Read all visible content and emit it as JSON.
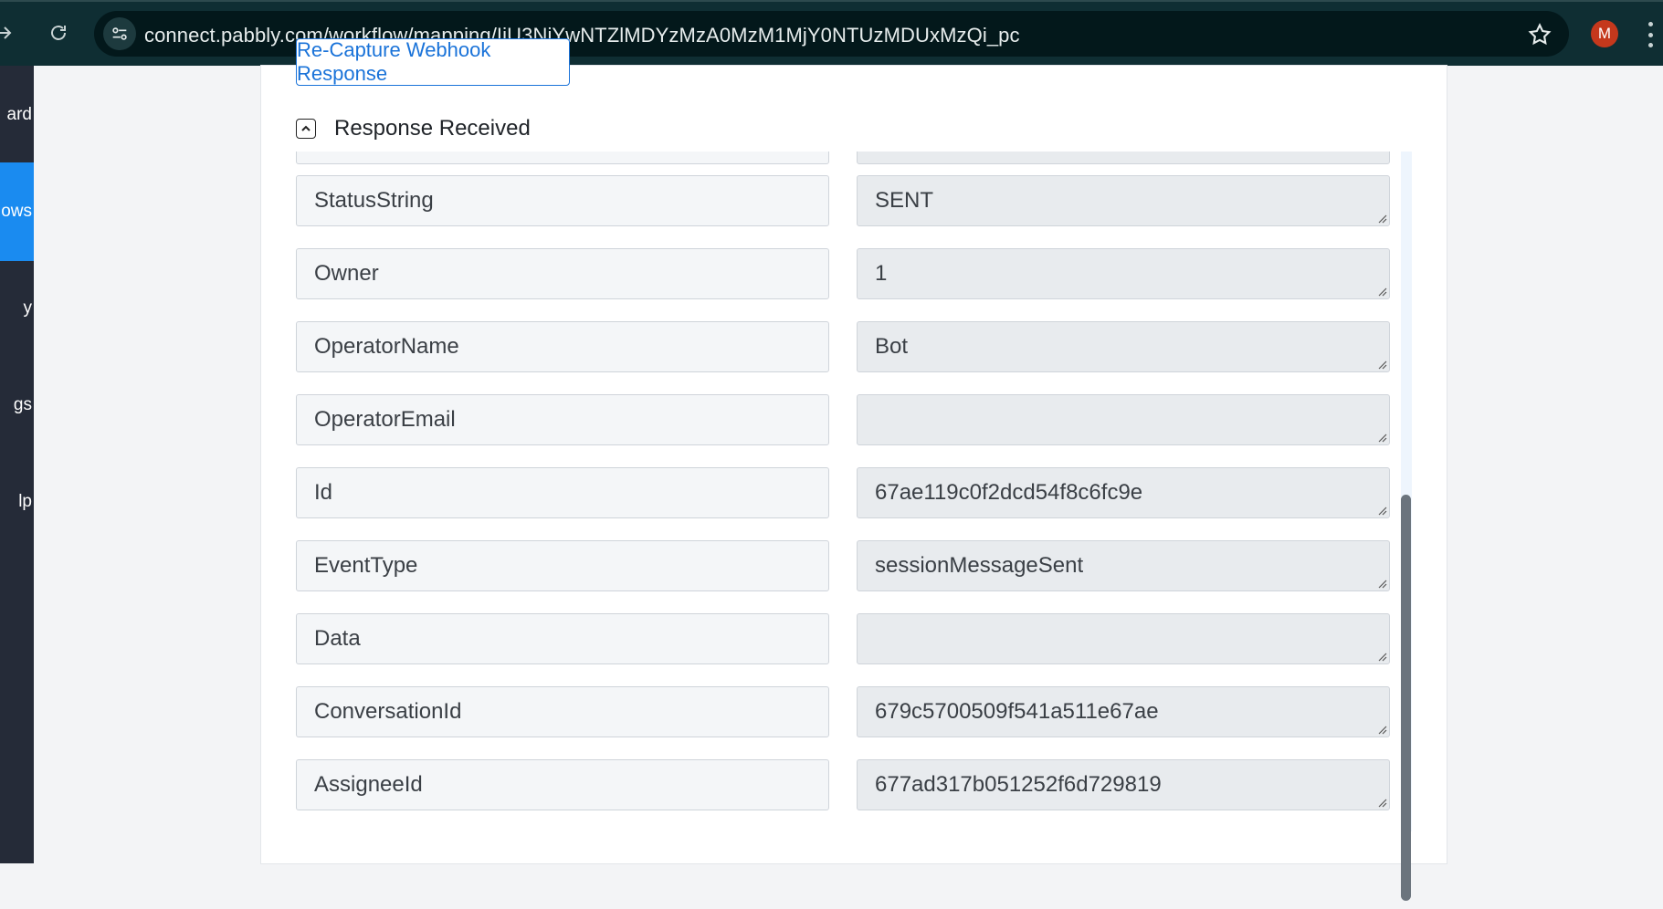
{
  "browser": {
    "url": "connect.pabbly.com/workflow/mapping/IjU3NjYwNTZlMDYzMzA0MzM1MjY0NTUzMDUxMzQi_pc",
    "profile_initial": "M"
  },
  "sidebar": {
    "items": [
      {
        "label": "ard"
      },
      {
        "label": "ows"
      },
      {
        "label": "y"
      },
      {
        "label": "gs"
      },
      {
        "label": "lp"
      }
    ],
    "active_index": 1
  },
  "main": {
    "recapture_label": "Re-Capture Webhook Response",
    "section_title": "Response Received",
    "rows": [
      {
        "key": "StatusString",
        "value": "SENT"
      },
      {
        "key": "Owner",
        "value": "1"
      },
      {
        "key": "OperatorName",
        "value": "Bot"
      },
      {
        "key": "OperatorEmail",
        "value": ""
      },
      {
        "key": "Id",
        "value": "67ae119c0f2dcd54f8c6fc9e"
      },
      {
        "key": "EventType",
        "value": "sessionMessageSent"
      },
      {
        "key": "Data",
        "value": ""
      },
      {
        "key": "ConversationId",
        "value": "679c5700509f541a511e67ae"
      },
      {
        "key": "AssigneeId",
        "value": "677ad317b051252f6d729819"
      }
    ]
  },
  "colors": {
    "toolbar_bg": "#0f2e33",
    "sidebar_bg": "#252b38",
    "sidebar_active": "#1a8bf0",
    "accent_blue": "#1a73d9"
  }
}
